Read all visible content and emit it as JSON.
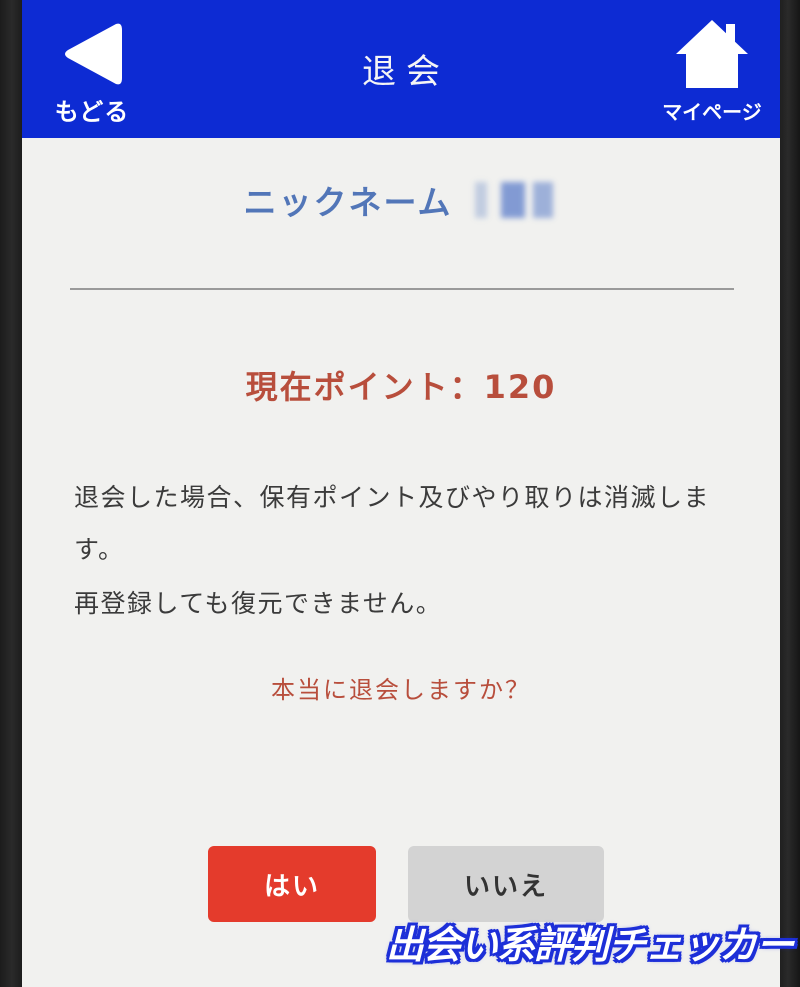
{
  "header": {
    "title": "退会",
    "back_label": "もどる",
    "home_label": "マイページ"
  },
  "profile": {
    "nickname_label": "ニックネーム",
    "nickname_value": ""
  },
  "points": {
    "text": "現在ポイント：120"
  },
  "notice": {
    "line1": "退会した場合、保有ポイント及びやり取りは消滅します。",
    "line2": "再登録しても復元できません。"
  },
  "confirm": {
    "question": "本当に退会しますか？",
    "yes_label": "はい",
    "no_label": "いいえ"
  },
  "watermark": {
    "text": "出会い系評判チェッカー"
  },
  "colors": {
    "header_bg": "#0d2bd3",
    "accent_red": "#e43b2c",
    "text_red": "#b84e3c",
    "nickname_blue": "#5276b8",
    "neutral_button": "#d3d3d3"
  },
  "icons": {
    "back": "back-triangle-icon",
    "home": "home-icon"
  }
}
